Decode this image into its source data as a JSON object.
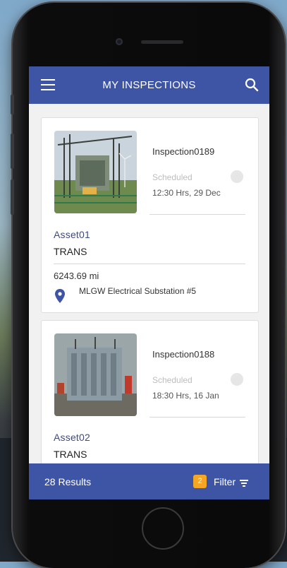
{
  "header": {
    "title": "MY INSPECTIONS",
    "menu_icon": "menu-icon",
    "search_icon": "search-icon"
  },
  "inspections": [
    {
      "id": "Inspection0189",
      "status": "Scheduled",
      "time": "12:30 Hrs, 29 Dec",
      "asset": "Asset01",
      "asset_type": "TRANS",
      "distance": "6243.69 mi",
      "location": "MLGW Electrical Substation #5"
    },
    {
      "id": "Inspection0188",
      "status": "Scheduled",
      "time": "18:30 Hrs, 16 Jan",
      "asset": "Asset02",
      "asset_type": "TRANS"
    }
  ],
  "footer": {
    "results": "28 Results",
    "filter_count": "2",
    "filter_label": "Filter"
  },
  "colors": {
    "primary": "#3e55a6",
    "badge": "#f5a623",
    "asset_text": "#3e4a80"
  }
}
